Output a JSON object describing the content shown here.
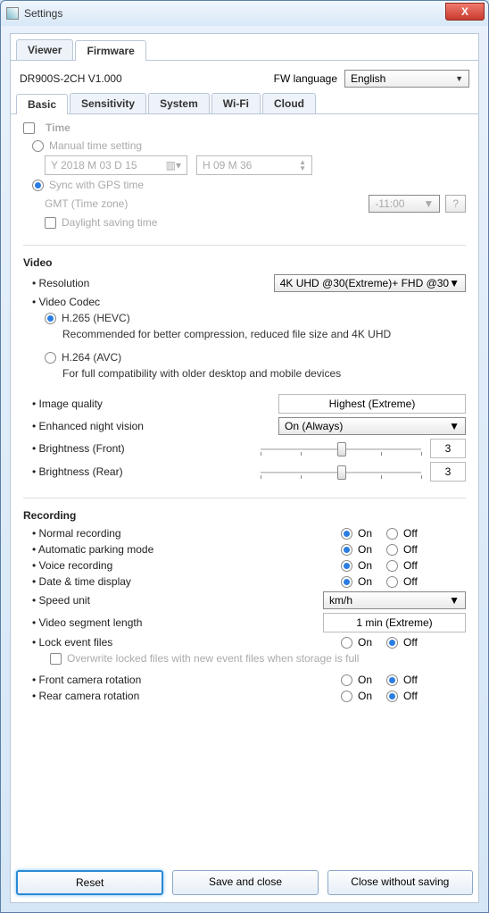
{
  "window": {
    "title": "Settings",
    "close_glyph": "X"
  },
  "topTabs": {
    "viewer": "Viewer",
    "firmware": "Firmware"
  },
  "fw": {
    "model": "DR900S-2CH   V1.000",
    "lang_label": "FW language",
    "lang_value": "English"
  },
  "subTabs": {
    "basic": "Basic",
    "sensitivity": "Sensitivity",
    "system": "System",
    "wifi": "Wi-Fi",
    "cloud": "Cloud"
  },
  "time": {
    "heading": "Time",
    "manual": "Manual time setting",
    "date": "Y 2018 M 03 D 15",
    "hm": "H 09 M 36",
    "sync": "Sync with GPS time",
    "gmt_label": "GMT (Time zone)",
    "gmt_value": "-11:00",
    "help": "?",
    "dst": "Daylight saving time"
  },
  "video": {
    "heading": "Video",
    "resolution_label": "Resolution",
    "resolution_value": "4K UHD @30(Extreme)+ FHD @30",
    "codec_label": "Video Codec",
    "h265": "H.265 (HEVC)",
    "h265_desc": "Recommended for better compression, reduced file size and 4K UHD",
    "h264": "H.264 (AVC)",
    "h264_desc": "For full compatibility with older desktop and mobile devices",
    "iq_label": "Image quality",
    "iq_value": "Highest (Extreme)",
    "env_label": "Enhanced night vision",
    "env_value": "On (Always)",
    "bf_label": "Brightness (Front)",
    "bf_value": "3",
    "br_label": "Brightness (Rear)",
    "br_value": "3"
  },
  "recording": {
    "heading": "Recording",
    "on": "On",
    "off": "Off",
    "normal": "Normal recording",
    "auto_park": "Automatic parking mode",
    "voice": "Voice recording",
    "datetime": "Date & time display",
    "speed_label": "Speed unit",
    "speed_value": "km/h",
    "seg_label": "Video segment length",
    "seg_value": "1 min (Extreme)",
    "lock": "Lock event files",
    "overwrite": "Overwrite locked files with new event files when storage is full",
    "front_rot": "Front camera rotation",
    "rear_rot": "Rear camera rotation"
  },
  "footer": {
    "reset": "Reset",
    "save": "Save and close",
    "close": "Close without saving"
  }
}
